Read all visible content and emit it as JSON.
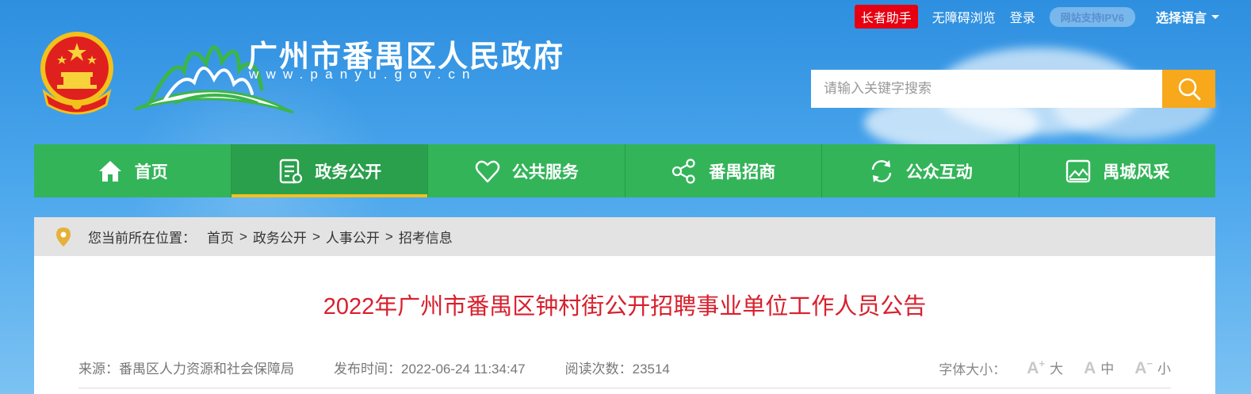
{
  "header": {
    "site_title": "广州市番禺区人民政府",
    "site_url": "www.panyu.gov.cn"
  },
  "topbar": {
    "elder_assistant": "长者助手",
    "accessible_browse": "无障碍浏览",
    "login": "登录",
    "ipv6_badge": "网站支持IPV6",
    "language": "选择语言"
  },
  "search": {
    "placeholder": "请输入关键字搜索"
  },
  "nav": {
    "items": [
      {
        "label": "首页",
        "icon": "home-icon"
      },
      {
        "label": "政务公开",
        "icon": "document-icon",
        "active": true
      },
      {
        "label": "公共服务",
        "icon": "heart-icon"
      },
      {
        "label": "番禺招商",
        "icon": "share-icon"
      },
      {
        "label": "公众互动",
        "icon": "refresh-icon"
      },
      {
        "label": "禺城风采",
        "icon": "picture-icon"
      }
    ]
  },
  "breadcrumb": {
    "prefix": "您当前所在位置：",
    "items": [
      "首页",
      "政务公开",
      "人事公开",
      "招考信息"
    ],
    "separator": ">"
  },
  "article": {
    "title": "2022年广州市番禺区钟村街公开招聘事业单位工作人员公告",
    "source": "来源：番禺区人力资源和社会保障局",
    "publish_time": "发布时间：2022-06-24 11:34:47",
    "read_count": "阅读次数：23514",
    "font_size_label": "字体大小：",
    "font_large": "大",
    "font_medium": "中",
    "font_small": "小"
  },
  "colors": {
    "nav_green": "#33b459",
    "accent_yellow": "#f7a81b",
    "title_red": "#d8202d",
    "elder_red": "#e60012"
  }
}
